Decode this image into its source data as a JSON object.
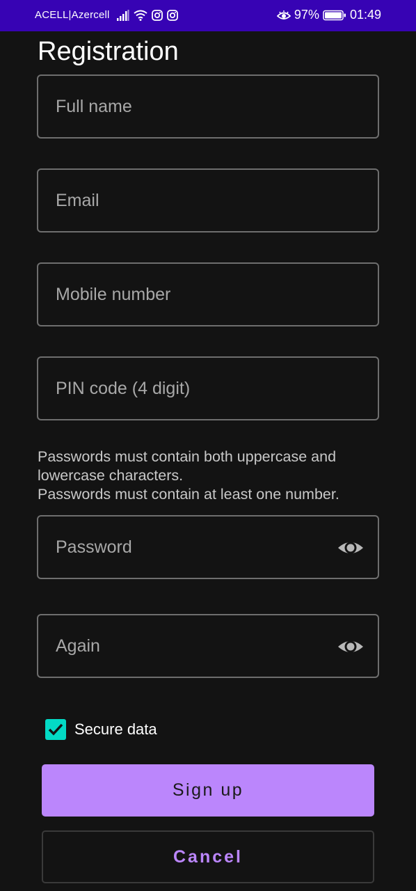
{
  "status_bar": {
    "carrier": "ACELL|Azercell",
    "battery": "97%",
    "time": "01:49"
  },
  "form": {
    "title": "Registration",
    "full_name_placeholder": "Full name",
    "email_placeholder": "Email",
    "mobile_placeholder": "Mobile number",
    "pin_placeholder": "PIN code (4 digit)",
    "hint_line1": "Passwords must contain both uppercase and",
    "hint_line2": "lowercase characters.",
    "hint_line3": "Passwords must contain at least one number.",
    "password_placeholder": "Password",
    "again_placeholder": "Again",
    "secure_label": "Secure data",
    "secure_checked": true,
    "signup_label": "Sign up",
    "cancel_label": "Cancel"
  },
  "colors": {
    "status_bar": "#3703b4",
    "background": "#131313",
    "accent": "#bb86fc",
    "checkbox": "#03dac5"
  },
  "icons": [
    "signal-icon",
    "wifi-icon",
    "instagram-icon",
    "eye-comfort-icon",
    "battery-icon",
    "visibility-eye-icon",
    "check-icon"
  ]
}
